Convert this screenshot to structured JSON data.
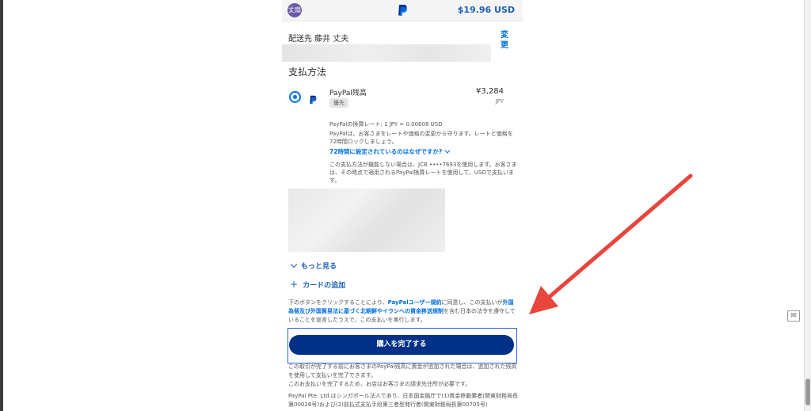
{
  "header": {
    "avatar_text": "丈扇",
    "amount": "$19.96 USD"
  },
  "shipping": {
    "label": "配送先 藤井 丈夫",
    "change_link": "変更"
  },
  "payment": {
    "title": "支払方法",
    "balance_name": "PayPal残高",
    "badge": "優先",
    "price": "¥3,284",
    "currency": "JPY",
    "rate_text": "PayPalの換算レート: 1 JPY = 0.00608 USD",
    "rate_desc": "PayPalは、お客さまをレートや価格の変更から守ります。レートと価格を72時間ロックしましょう。",
    "why_link": "72時間に設定されているのはなぜですか?",
    "fallback_text": "この支払方法が機能しない場合は、JCB ••••7693を使用します。お客さまは、その時点で適用されるPayPal換算レートを使用して、USDで支払います。"
  },
  "more_link": "もっと見る",
  "add_card": "カードの追加",
  "legal": {
    "part1": "下のボタンをクリックすることにより、",
    "link1": "PayPalユーザー規約",
    "part2": "に同意し、この支払いが",
    "link2": "外国為替及び外国貿易法に基づく北朝鮮やイランへの資金移送規制",
    "part3": "を含む日本の法令を遵守していることを宣言したうえで、この支払いを実行します。"
  },
  "complete_button": "購入を完了する",
  "notes": {
    "n1": "この取引が完了する前にお客さまのPayPal残高に資金が追加された場合は、追加された残高を使用して支払いを完了できます。",
    "n2": "このお支払いを完了するため、お店はお客さまの請求先住所が必要です。",
    "n3": "PayPal Pte. Ltd.はシンガポール法人であり、日本国金融庁で(1)資金移動業者(関東財務局長第00026号)および(2)前払式支払手段第三者型発行者(関東財務局長第00705号)"
  },
  "colors": {
    "brand_navy": "#003087",
    "link_blue": "#0070e0",
    "arrow_red": "#e8453c"
  }
}
